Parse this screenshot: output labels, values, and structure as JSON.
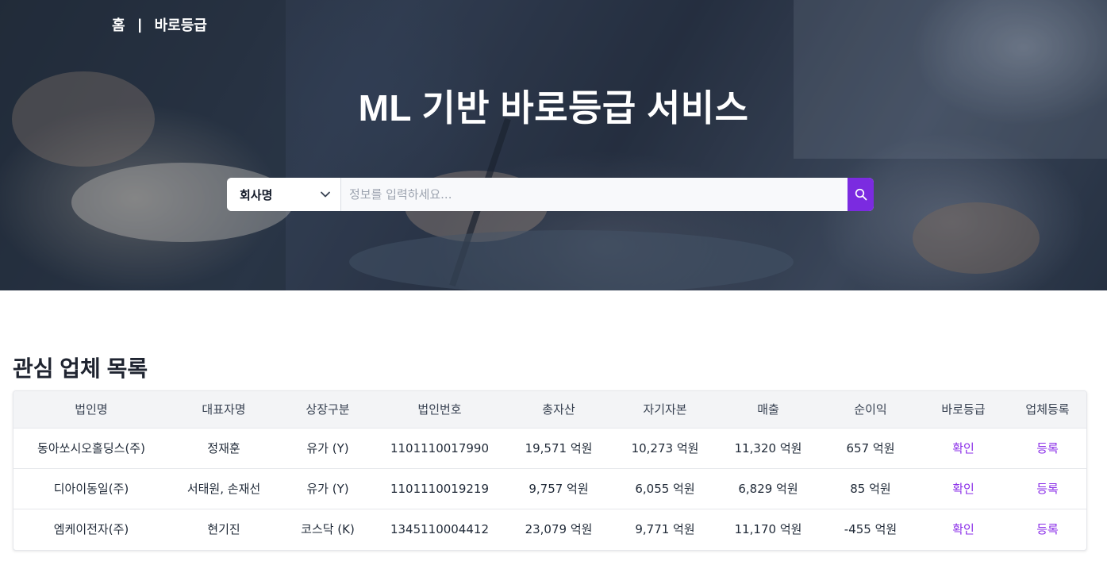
{
  "breadcrumb": {
    "home": "홈",
    "separator": "|",
    "current": "바로등급"
  },
  "hero": {
    "title": "ML 기반 바로등급 서비스"
  },
  "search": {
    "select_value": "회사명",
    "placeholder": "정보를 입력하세요...",
    "button_icon": "search-icon",
    "accent_color": "#7b2be0"
  },
  "section": {
    "title": "관심 업체 목록"
  },
  "table": {
    "columns": [
      "법인명",
      "대표자명",
      "상장구분",
      "법인번호",
      "총자산",
      "자기자본",
      "매출",
      "순이익",
      "바로등급",
      "업체등록"
    ],
    "rows": [
      {
        "name": "동아쏘시오홀딩스(주)",
        "ceo": "정재훈",
        "listing": "유가 (Y)",
        "corp_no": "1101110017990",
        "assets": "19,571 억원",
        "equity": "10,273 억원",
        "sales": "11,320 억원",
        "net_income": "657 억원",
        "grade": "확인",
        "register": "등록"
      },
      {
        "name": "디아이동일(주)",
        "ceo": "서태원, 손재선",
        "listing": "유가 (Y)",
        "corp_no": "1101110019219",
        "assets": "9,757 억원",
        "equity": "6,055 억원",
        "sales": "6,829 억원",
        "net_income": "85 억원",
        "grade": "확인",
        "register": "등록"
      },
      {
        "name": "엠케이전자(주)",
        "ceo": "현기진",
        "listing": "코스닥 (K)",
        "corp_no": "1345110004412",
        "assets": "23,079 억원",
        "equity": "9,771 억원",
        "sales": "11,170 억원",
        "net_income": "-455 억원",
        "grade": "확인",
        "register": "등록"
      }
    ],
    "link_color": "#8b2fe8"
  }
}
